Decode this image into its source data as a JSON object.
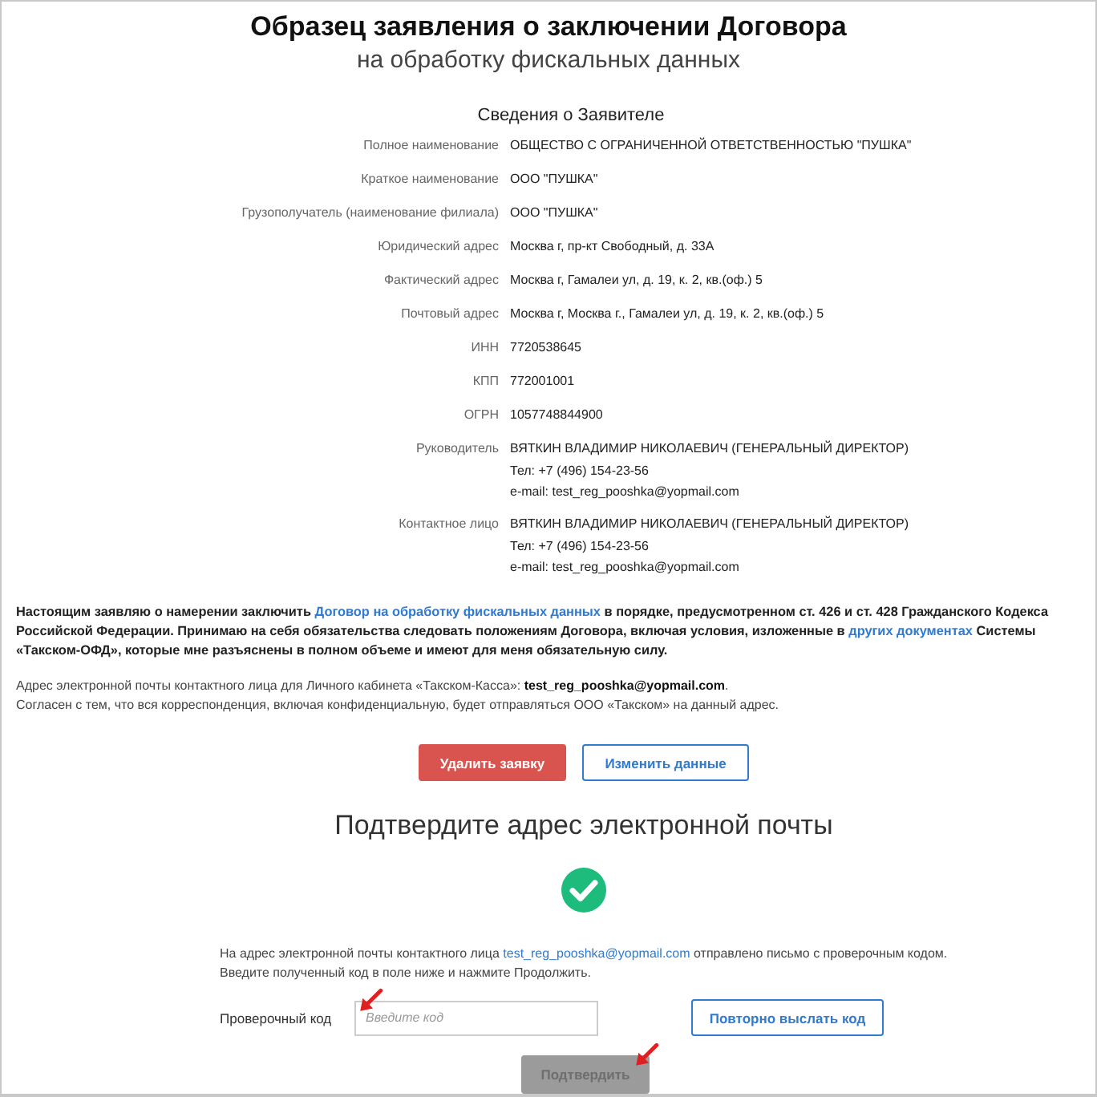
{
  "title": "Образец заявления о заключении Договора",
  "subtitle": "на обработку фискальных данных",
  "section_title": "Сведения о Заявителе",
  "fields": [
    {
      "label": "Полное наименование",
      "lines": [
        "ОБЩЕСТВО С ОГРАНИЧЕННОЙ ОТВЕТСТВЕННОСТЬЮ \"ПУШКА\""
      ]
    },
    {
      "label": "Краткое наименование",
      "lines": [
        "ООО \"ПУШКА\""
      ]
    },
    {
      "label": "Грузополучатель (наименование филиала)",
      "lines": [
        "ООО \"ПУШКА\""
      ]
    },
    {
      "label": "Юридический адрес",
      "lines": [
        "Москва г, пр-кт Свободный, д. 33А"
      ]
    },
    {
      "label": "Фактический адрес",
      "lines": [
        "Москва г, Гамалеи ул, д. 19, к. 2, кв.(оф.) 5"
      ]
    },
    {
      "label": "Почтовый адрес",
      "lines": [
        "Москва г, Москва г., Гамалеи ул, д. 19, к. 2, кв.(оф.) 5"
      ]
    },
    {
      "label": "ИНН",
      "lines": [
        "7720538645"
      ]
    },
    {
      "label": "КПП",
      "lines": [
        "772001001"
      ]
    },
    {
      "label": "ОГРН",
      "lines": [
        "1057748844900"
      ]
    },
    {
      "label": "Руководитель",
      "lines": [
        "ВЯТКИН ВЛАДИМИР НИКОЛАЕВИЧ (ГЕНЕРАЛЬНЫЙ ДИРЕКТОР)",
        "Тел: +7 (496) 154-23-56",
        "e-mail: test_reg_pooshka@yopmail.com"
      ]
    },
    {
      "label": "Контактное лицо",
      "lines": [
        "ВЯТКИН ВЛАДИМИР НИКОЛАЕВИЧ (ГЕНЕРАЛЬНЫЙ ДИРЕКТОР)",
        "Тел: +7 (496) 154-23-56",
        "e-mail: test_reg_pooshka@yopmail.com"
      ]
    }
  ],
  "statement": [
    {
      "kind": "text",
      "text": "Настоящим заявляю о намерении заключить "
    },
    {
      "kind": "link",
      "text": "Договор на обработку фискальных данных"
    },
    {
      "kind": "text",
      "text": " в порядке, предусмотренном ст. 426 и ст. 428 Гражданского Кодекса Российской Федерации. Принимаю на себя обязательства следовать положениям Договора, включая условия, изложенные в "
    },
    {
      "kind": "link",
      "text": "других документах"
    },
    {
      "kind": "text",
      "text": " Системы «Такском-ОФД», которые мне разъяснены в полном объеме и имеют для меня обязательную силу."
    }
  ],
  "email_note": "Адрес электронной почты контактного лица для Личного кабинета «Такском-Касса»: **test_reg_pooshka@yopmail.com**.",
  "consent": "Согласен с тем, что вся корреспонденция, включая конфиденциальную, будет отправляться ООО «Такском» на данный адрес.",
  "actions": [
    {
      "kind": "danger",
      "label": "Удалить заявку"
    },
    {
      "kind": "outline",
      "label": "Изменить данные"
    }
  ],
  "confirm_title": "Подтвердите адрес электронной почты",
  "confirm_text": [
    {
      "kind": "text",
      "text": "На адрес электронной почты контактного лица "
    },
    {
      "kind": "link",
      "text": "test_reg_pooshka@yopmail.com"
    },
    {
      "kind": "text",
      "text": " отправлено письмо с проверочным кодом. Введите полученный код в поле ниже и нажмите Продолжить."
    }
  ],
  "code_label": "Проверочный код",
  "code_placeholder": "Введите код",
  "resend": {
    "label": "Повторно выслать код"
  },
  "submit": {
    "label": "Подтвердить",
    "disabled": true
  }
}
